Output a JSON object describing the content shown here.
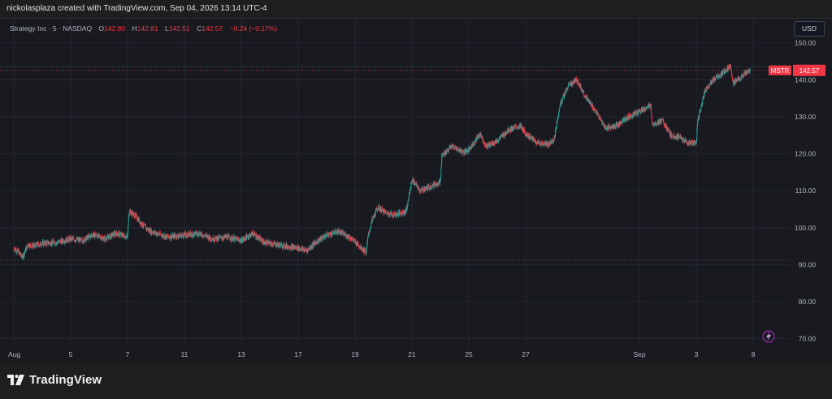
{
  "header": {
    "credit": "nickolasplaza created with TradingView.com, Sep 04, 2026 13:14 UTC-4"
  },
  "legend": {
    "symbol": "Strategy Inc · 5 · NASDAQ",
    "open_label": "O",
    "open": "142.80",
    "high_label": "H",
    "high": "142.81",
    "low_label": "L",
    "low": "142.51",
    "close_label": "C",
    "close": "142.57",
    "change": "−0.24 (−0.17%)"
  },
  "currency": "USD",
  "price_badge": {
    "ticker": "MSTR",
    "price": "142.57",
    "ticker_color": "#f23645",
    "price_color": "#f23645"
  },
  "colors": {
    "up": "#26a69a",
    "down": "#f23645",
    "background": "#181a20",
    "grid": "#232632"
  },
  "footer": {
    "brand": "TradingView"
  },
  "chart_data": {
    "type": "candlestick",
    "symbol": "MSTR",
    "interval": "5",
    "y_ticks": [
      70,
      80,
      90,
      100,
      110,
      120,
      130,
      140,
      150
    ],
    "y_tick_labels": [
      "70.00",
      "80.00",
      "90.00",
      "100.00",
      "110.00",
      "120.00",
      "130.00",
      "140.00",
      "150.00"
    ],
    "ylim": [
      67.5,
      157.5
    ],
    "x_ticks": [
      "Aug",
      "5",
      "7",
      "11",
      "13",
      "17",
      "19",
      "21",
      "25",
      "27",
      "Sep",
      "3",
      "8"
    ],
    "x_tick_sessions": [
      0,
      2,
      4,
      6,
      8,
      10,
      12,
      14,
      16,
      18,
      22,
      24,
      26
    ],
    "sessions_span": [
      0,
      27
    ],
    "last_price": 142.57,
    "high_line": 143.5,
    "low_line": 91.2,
    "price_path": [
      [
        0.0,
        94.5
      ],
      [
        0.15,
        93.5
      ],
      [
        0.3,
        92.0
      ],
      [
        0.5,
        95.5
      ],
      [
        0.7,
        95.0
      ],
      [
        1.0,
        95.8
      ],
      [
        1.5,
        96.0
      ],
      [
        2.0,
        97.0
      ],
      [
        2.4,
        96.5
      ],
      [
        2.8,
        98.2
      ],
      [
        3.2,
        97.0
      ],
      [
        3.6,
        98.5
      ],
      [
        4.0,
        97.5
      ],
      [
        4.05,
        104.5
      ],
      [
        4.3,
        103.0
      ],
      [
        4.5,
        101.0
      ],
      [
        4.7,
        99.5
      ],
      [
        5.0,
        98.5
      ],
      [
        5.4,
        97.5
      ],
      [
        6.0,
        98.0
      ],
      [
        6.5,
        98.5
      ],
      [
        7.0,
        97.0
      ],
      [
        7.5,
        97.5
      ],
      [
        8.0,
        96.5
      ],
      [
        8.4,
        98.5
      ],
      [
        8.8,
        96.0
      ],
      [
        9.2,
        95.5
      ],
      [
        9.6,
        95.0
      ],
      [
        10.0,
        94.5
      ],
      [
        10.3,
        93.8
      ],
      [
        10.6,
        96.0
      ],
      [
        11.0,
        98.0
      ],
      [
        11.4,
        99.0
      ],
      [
        11.8,
        97.5
      ],
      [
        12.1,
        95.5
      ],
      [
        12.4,
        93.3
      ],
      [
        12.45,
        97.5
      ],
      [
        12.6,
        102.0
      ],
      [
        12.8,
        105.5
      ],
      [
        13.1,
        104.0
      ],
      [
        13.4,
        103.5
      ],
      [
        13.8,
        104.5
      ],
      [
        14.0,
        113.0
      ],
      [
        14.3,
        110.0
      ],
      [
        14.6,
        111.0
      ],
      [
        15.0,
        112.5
      ],
      [
        15.05,
        119.5
      ],
      [
        15.4,
        122.0
      ],
      [
        15.8,
        120.5
      ],
      [
        16.0,
        121.0
      ],
      [
        16.4,
        125.5
      ],
      [
        16.6,
        122.0
      ],
      [
        17.0,
        123.5
      ],
      [
        17.4,
        126.5
      ],
      [
        17.8,
        127.5
      ],
      [
        18.0,
        125.5
      ],
      [
        18.4,
        123.0
      ],
      [
        18.8,
        122.5
      ],
      [
        19.0,
        124.0
      ],
      [
        19.2,
        133.0
      ],
      [
        19.5,
        138.5
      ],
      [
        19.8,
        140.0
      ],
      [
        20.1,
        135.5
      ],
      [
        20.5,
        131.0
      ],
      [
        20.8,
        127.0
      ],
      [
        21.2,
        127.5
      ],
      [
        21.6,
        130.0
      ],
      [
        22.0,
        131.5
      ],
      [
        22.4,
        133.0
      ],
      [
        22.45,
        128.0
      ],
      [
        22.8,
        129.0
      ],
      [
        23.1,
        125.0
      ],
      [
        23.4,
        124.5
      ],
      [
        23.7,
        123.0
      ],
      [
        24.0,
        123.0
      ],
      [
        24.05,
        129.0
      ],
      [
        24.3,
        137.0
      ],
      [
        24.6,
        140.0
      ],
      [
        24.9,
        141.5
      ],
      [
        25.2,
        144.0
      ],
      [
        25.3,
        139.0
      ],
      [
        25.6,
        141.0
      ],
      [
        25.9,
        142.6
      ]
    ]
  }
}
